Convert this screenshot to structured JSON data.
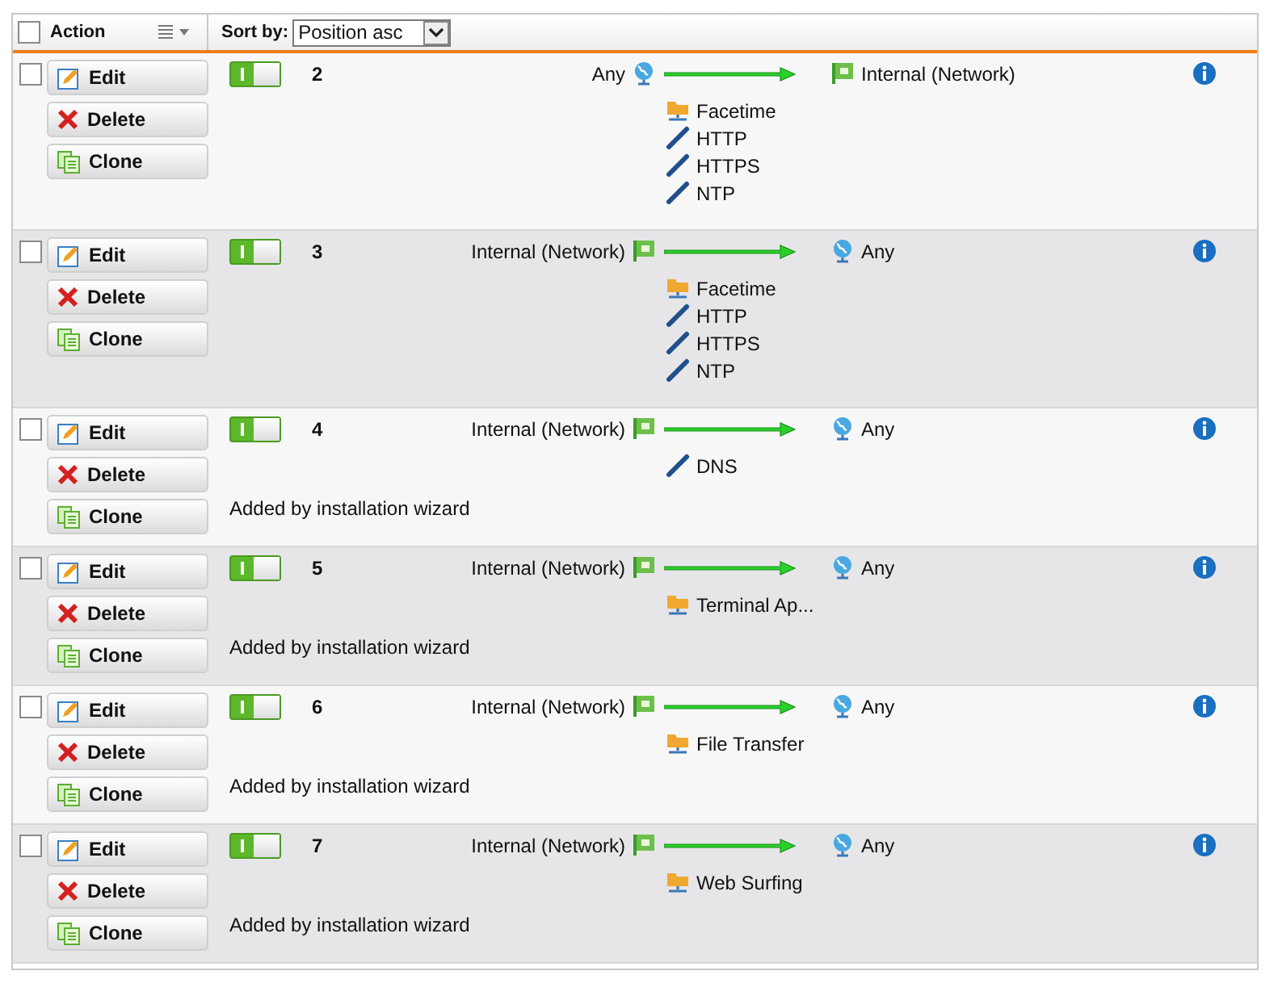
{
  "header": {
    "select_all_checked": false,
    "action_label": "Action",
    "sort_label": "Sort by:",
    "sort_value": "Position asc"
  },
  "rows": [
    {
      "checked": false,
      "actions": [
        {
          "kind": "edit",
          "label": "Edit"
        },
        {
          "kind": "delete",
          "label": "Delete"
        },
        {
          "kind": "clone",
          "label": "Clone"
        }
      ],
      "enabled": true,
      "number": "2",
      "source": {
        "kind": "any",
        "text": "Any"
      },
      "destination": {
        "kind": "network",
        "text": "Internal (Network)"
      },
      "services": [
        {
          "kind": "group",
          "name": "Facetime"
        },
        {
          "kind": "service",
          "name": "HTTP"
        },
        {
          "kind": "service",
          "name": "HTTPS"
        },
        {
          "kind": "service",
          "name": "NTP"
        }
      ]
    },
    {
      "checked": false,
      "actions": [
        {
          "kind": "edit",
          "label": "Edit"
        },
        {
          "kind": "delete",
          "label": "Delete"
        },
        {
          "kind": "clone",
          "label": "Clone"
        }
      ],
      "enabled": true,
      "number": "3",
      "source": {
        "kind": "network",
        "text": "Internal (Network)"
      },
      "destination": {
        "kind": "any",
        "text": "Any"
      },
      "services": [
        {
          "kind": "group",
          "name": "Facetime"
        },
        {
          "kind": "service",
          "name": "HTTP"
        },
        {
          "kind": "service",
          "name": "HTTPS"
        },
        {
          "kind": "service",
          "name": "NTP"
        }
      ]
    },
    {
      "checked": false,
      "actions": [
        {
          "kind": "edit",
          "label": "Edit"
        },
        {
          "kind": "delete",
          "label": "Delete"
        },
        {
          "kind": "clone",
          "label": "Clone"
        }
      ],
      "enabled": true,
      "number": "4",
      "source": {
        "kind": "network",
        "text": "Internal (Network)"
      },
      "destination": {
        "kind": "any",
        "text": "Any"
      },
      "services": [
        {
          "kind": "service",
          "name": "DNS"
        }
      ],
      "comment": "Added by installation wizard"
    },
    {
      "checked": false,
      "actions": [
        {
          "kind": "edit",
          "label": "Edit"
        },
        {
          "kind": "delete",
          "label": "Delete"
        },
        {
          "kind": "clone",
          "label": "Clone"
        }
      ],
      "enabled": true,
      "number": "5",
      "source": {
        "kind": "network",
        "text": "Internal (Network)"
      },
      "destination": {
        "kind": "any",
        "text": "Any"
      },
      "services": [
        {
          "kind": "group",
          "name": "Terminal Ap..."
        }
      ],
      "comment": "Added by installation wizard"
    },
    {
      "checked": false,
      "actions": [
        {
          "kind": "edit",
          "label": "Edit"
        },
        {
          "kind": "delete",
          "label": "Delete"
        },
        {
          "kind": "clone",
          "label": "Clone"
        }
      ],
      "enabled": true,
      "number": "6",
      "source": {
        "kind": "network",
        "text": "Internal (Network)"
      },
      "destination": {
        "kind": "any",
        "text": "Any"
      },
      "services": [
        {
          "kind": "group",
          "name": "File Transfer"
        }
      ],
      "comment": "Added by installation wizard"
    },
    {
      "checked": false,
      "actions": [
        {
          "kind": "edit",
          "label": "Edit"
        },
        {
          "kind": "delete",
          "label": "Delete"
        },
        {
          "kind": "clone",
          "label": "Clone"
        }
      ],
      "enabled": true,
      "number": "7",
      "source": {
        "kind": "network",
        "text": "Internal (Network)"
      },
      "destination": {
        "kind": "any",
        "text": "Any"
      },
      "services": [
        {
          "kind": "group",
          "name": "Web Surfing"
        }
      ],
      "comment": "Added by installation wizard"
    }
  ]
}
